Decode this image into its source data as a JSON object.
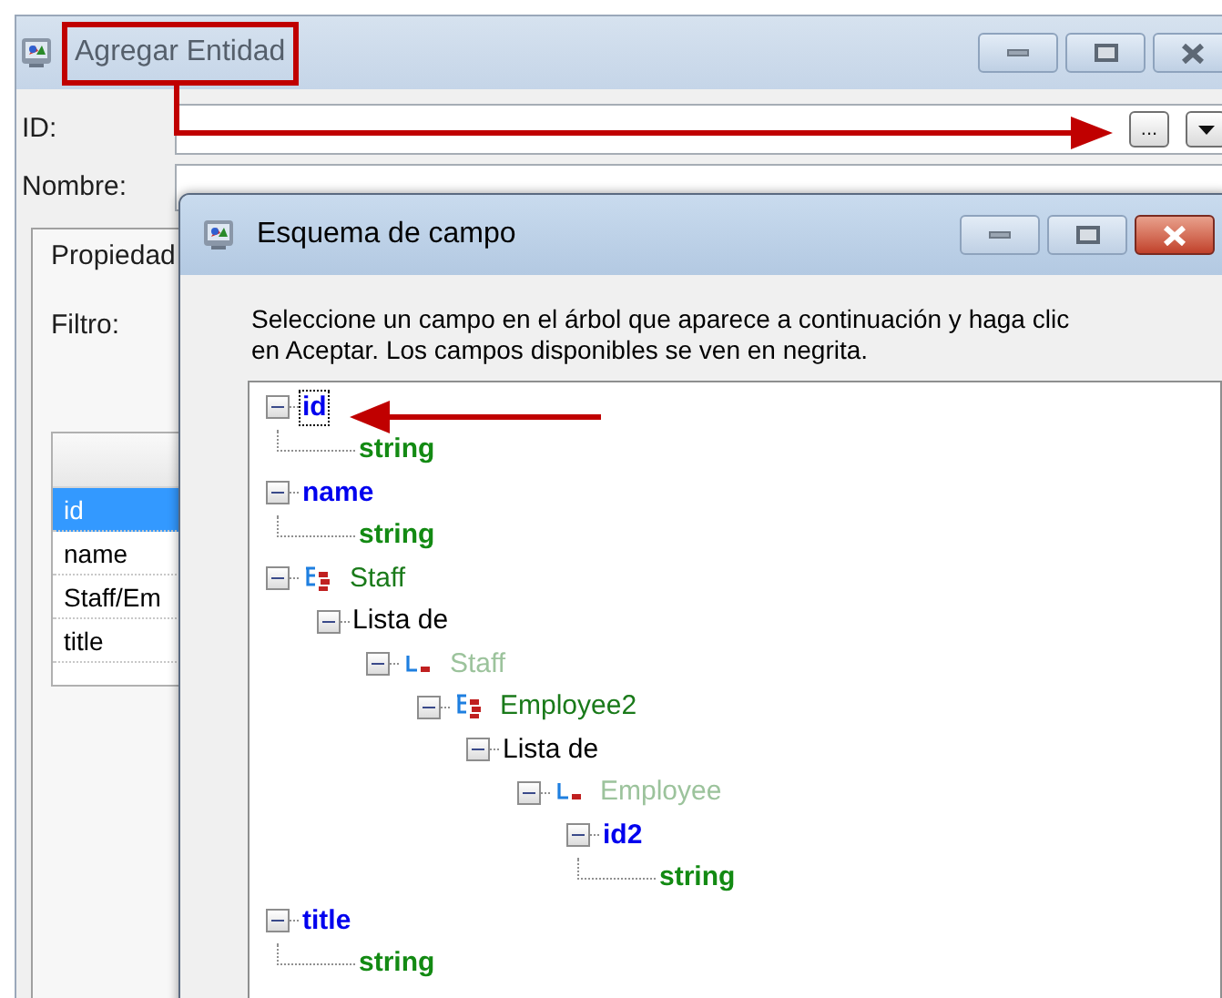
{
  "main_window": {
    "title": "Agregar Entidad",
    "id_label": "ID:",
    "browse_button": "...",
    "name_label": "Nombre:",
    "tab": "Propiedad",
    "filter_label": "Filtro:",
    "list": [
      {
        "label": "id",
        "selected": true
      },
      {
        "label": "name",
        "selected": false
      },
      {
        "label": "Staff/Em",
        "selected": false
      },
      {
        "label": "title",
        "selected": false
      }
    ]
  },
  "dialog": {
    "title": "Esquema de campo",
    "instructions": "Seleccione un campo en el árbol que aparece a continuación y haga clic en Aceptar. Los campos disponibles se ven en negrita.",
    "tree": [
      {
        "label": "id",
        "kind": "field",
        "selected": true,
        "expanded": true,
        "children": [
          {
            "label": "string",
            "kind": "type",
            "selected": false
          }
        ]
      },
      {
        "label": "name",
        "kind": "field",
        "selected": false,
        "expanded": true,
        "children": [
          {
            "label": "string",
            "kind": "type",
            "selected": false
          }
        ]
      },
      {
        "label": "Staff",
        "kind": "complex",
        "selected": false,
        "expanded": true,
        "children": [
          {
            "label": "Lista de",
            "kind": "list",
            "selected": false,
            "expanded": true,
            "children": [
              {
                "label": "Staff",
                "kind": "ref",
                "selected": false,
                "expanded": true,
                "children": [
                  {
                    "label": "Employee2",
                    "kind": "complex",
                    "selected": false,
                    "expanded": true,
                    "children": [
                      {
                        "label": "Lista de",
                        "kind": "list",
                        "selected": false,
                        "expanded": true,
                        "children": [
                          {
                            "label": "Employee",
                            "kind": "ref",
                            "selected": false,
                            "expanded": true,
                            "children": [
                              {
                                "label": "id2",
                                "kind": "field",
                                "selected": false,
                                "expanded": true,
                                "children": [
                                  {
                                    "label": "string",
                                    "kind": "type",
                                    "selected": false
                                  }
                                ]
                              }
                            ]
                          }
                        ]
                      }
                    ]
                  }
                ]
              }
            ]
          }
        ]
      },
      {
        "label": "title",
        "kind": "field",
        "selected": false,
        "expanded": true,
        "children": [
          {
            "label": "string",
            "kind": "type",
            "selected": false
          }
        ]
      }
    ]
  }
}
